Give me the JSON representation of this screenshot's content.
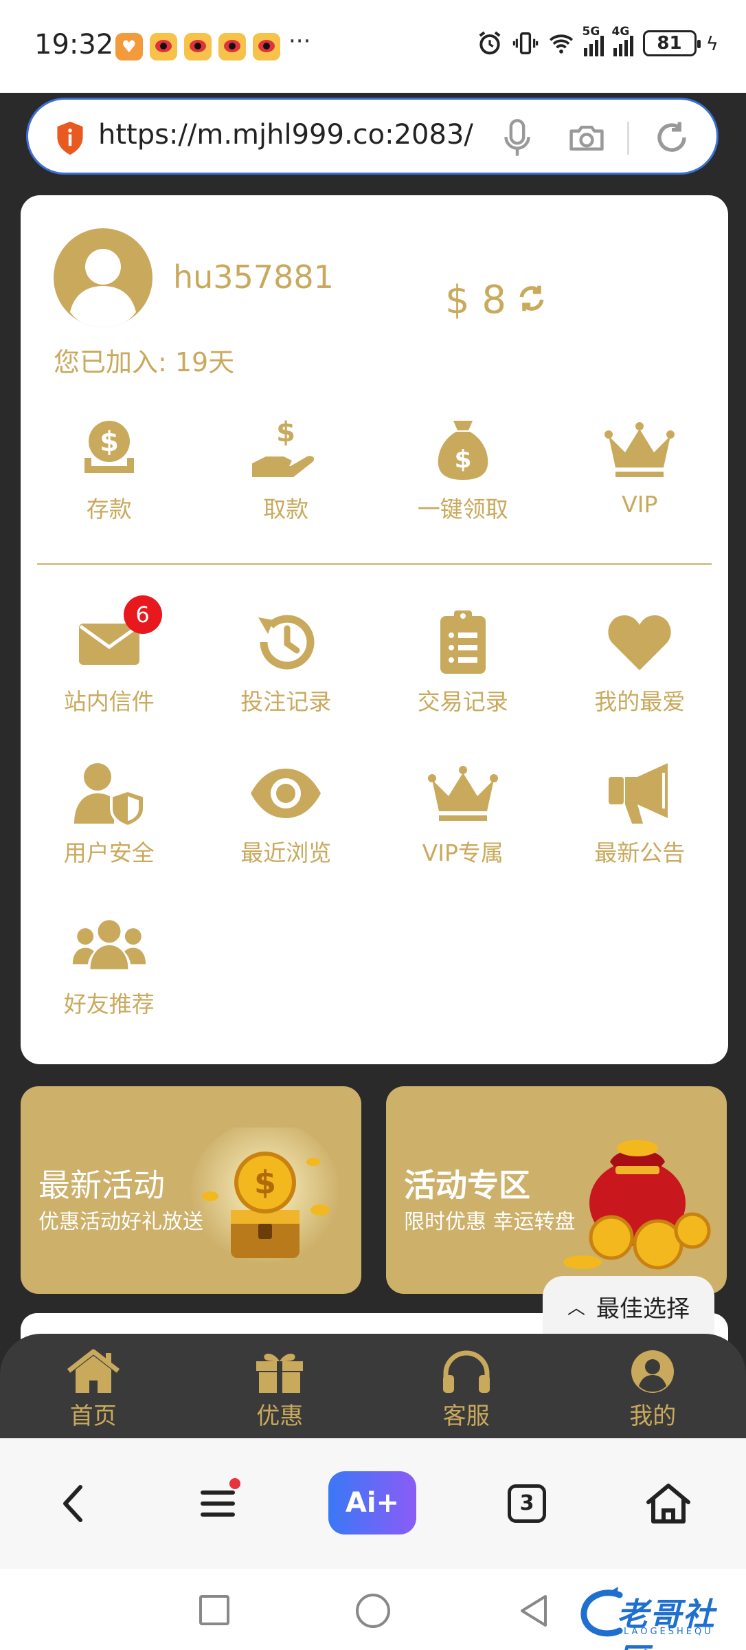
{
  "status_bar": {
    "time": "19:32",
    "dots": "···",
    "signal_5g": "5G",
    "signal_4g": "4G",
    "battery": "81"
  },
  "url_bar": {
    "url": "https://m.mjhl999.co:2083/"
  },
  "profile": {
    "username": "hu357881",
    "balance": "$ 8",
    "joined": "您已加入: 19天"
  },
  "quick_actions": [
    {
      "label": "存款",
      "icon": "deposit-coin-icon"
    },
    {
      "label": "取款",
      "icon": "withdraw-hand-icon"
    },
    {
      "label": "一键领取",
      "icon": "money-bag-icon"
    },
    {
      "label": "VIP",
      "icon": "crown-icon"
    }
  ],
  "menu": [
    {
      "label": "站内信件",
      "icon": "mail-icon",
      "badge": "6"
    },
    {
      "label": "投注记录",
      "icon": "history-icon"
    },
    {
      "label": "交易记录",
      "icon": "clipboard-list-icon"
    },
    {
      "label": "我的最爱",
      "icon": "heart-icon"
    },
    {
      "label": "用户安全",
      "icon": "user-shield-icon"
    },
    {
      "label": "最近浏览",
      "icon": "eye-icon"
    },
    {
      "label": "VIP专属",
      "icon": "crown-icon"
    },
    {
      "label": "最新公告",
      "icon": "megaphone-icon"
    },
    {
      "label": "好友推荐",
      "icon": "users-icon"
    }
  ],
  "promos": [
    {
      "title": "最新活动",
      "subtitle": "优惠活动好礼放送"
    },
    {
      "title": "活动专区",
      "subtitle": "限时优惠 幸运转盘"
    }
  ],
  "best_choice": "最佳选择",
  "tabs": [
    {
      "label": "首页",
      "icon": "home-icon"
    },
    {
      "label": "优惠",
      "icon": "gift-icon"
    },
    {
      "label": "客服",
      "icon": "headphones-icon"
    },
    {
      "label": "我的",
      "icon": "user-circle-icon"
    }
  ],
  "browser": {
    "ai_label": "Ai+",
    "tab_count": "3"
  },
  "watermark": {
    "text": "老哥社区",
    "sub": "LAOGESHEQU"
  },
  "colors": {
    "gold": "#c9a95c",
    "promo_bg": "#cdb06a",
    "dark_bg": "#2a2a2a",
    "tabbar_bg": "#3a3a3a",
    "badge_red": "#e8191e",
    "url_border": "#3b6fd8"
  }
}
